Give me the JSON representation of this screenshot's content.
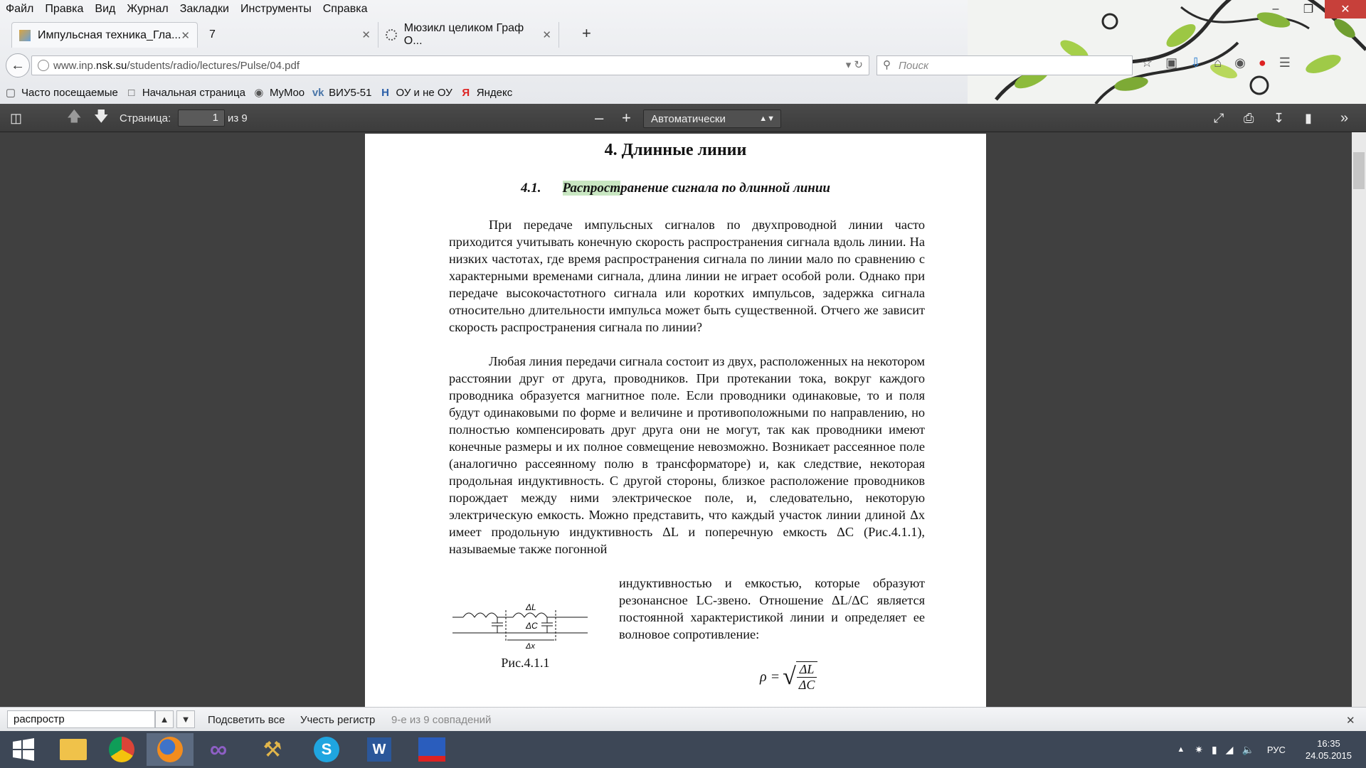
{
  "menu": [
    "Файл",
    "Правка",
    "Вид",
    "Журнал",
    "Закладки",
    "Инструменты",
    "Справка"
  ],
  "window_controls": {
    "minimize": "–",
    "maximize": "❐",
    "close": "✕"
  },
  "tabs": [
    {
      "title": "Импульсная техника_Гла...",
      "close": "✕"
    },
    {
      "title": "7",
      "close": "✕"
    },
    {
      "title": "Мюзикл целиком Граф О...",
      "close": "✕"
    }
  ],
  "new_tab": "+",
  "nav": {
    "url_prefix": "www.inp.",
    "url_domain": "nsk.su",
    "url_path": "/students/radio/lectures/Pulse/04.pdf",
    "search_placeholder": "Поиск"
  },
  "bookmarks": [
    "Часто посещаемые",
    "Начальная страница",
    "MyMoo",
    "ВИУ5-51",
    "ОУ и не ОУ",
    "Яндекс"
  ],
  "pdf_toolbar": {
    "page_label": "Страница:",
    "page_current": "1",
    "page_total": "из 9",
    "zoom": "Автоматически",
    "zoom_out": "–",
    "zoom_in": "+"
  },
  "document": {
    "chapter": "4.   Длинные линии",
    "section_num": "4.1.",
    "section_title_hl": "Распрост",
    "section_title_rest": "ранение сигнала по длинной линии",
    "para1": "При передаче импульсных сигналов по двухпроводной линии часто приходится учитывать конечную скорость распространения сигнала вдоль линии. На низких частотах, где время распространения сигнала по линии мало по сравнению с характерными временами сигнала, длина линии не играет особой роли. Однако при передаче высокочастотного сигнала или коротких импульсов, задержка сигнала относительно длительности импульса может быть существенной. Отчего же зависит скорость распространения сигнала по линии?",
    "para2": "Любая линия передачи сигнала состоит из двух, расположенных на некотором расстоянии друг от друга, проводников. При протекании тока, вокруг каждого проводника образуется магнитное поле. Если проводники одинаковые, то и поля будут одинаковыми по форме и величине и противоположными по направлению, но полностью компенсировать друг друга они не могут, так как проводники имеют конечные размеры и их полное совмещение невозможно. Возникает рассеянное поле (аналогично рассеянному полю в трансформаторе) и, как следствие, некоторая продольная индуктивность. С другой стороны, близкое расположение проводников порождает между ними электрическое поле, и, следовательно, некоторую электрическую емкость. Можно представить, что каждый участок линии длиной Δx имеет продольную индуктивность ΔL и поперечную емкость ΔC (Рис.4.1.1), называемые также погонной",
    "para3": "индуктивностью и емкостью, которые образуют резонансное LC-звено. Отношение ΔL/ΔC является постоянной характеристикой линии и определяет ее волновое сопротивление:",
    "fig_caption": "Рис.4.1.1",
    "fig_labels": {
      "L": "ΔL",
      "C": "ΔC",
      "x": "Δx"
    },
    "formula_lhs": "ρ =",
    "formula_num": "ΔL",
    "formula_den": "ΔC"
  },
  "findbar": {
    "query": "распростр",
    "highlight_all": "Подсветить все",
    "match_case": "Учесть регистр",
    "status": "9-е из 9 совпадений",
    "close": "✕"
  },
  "tray": {
    "lang": "РУС",
    "time": "16:35",
    "date": "24.05.2015"
  }
}
